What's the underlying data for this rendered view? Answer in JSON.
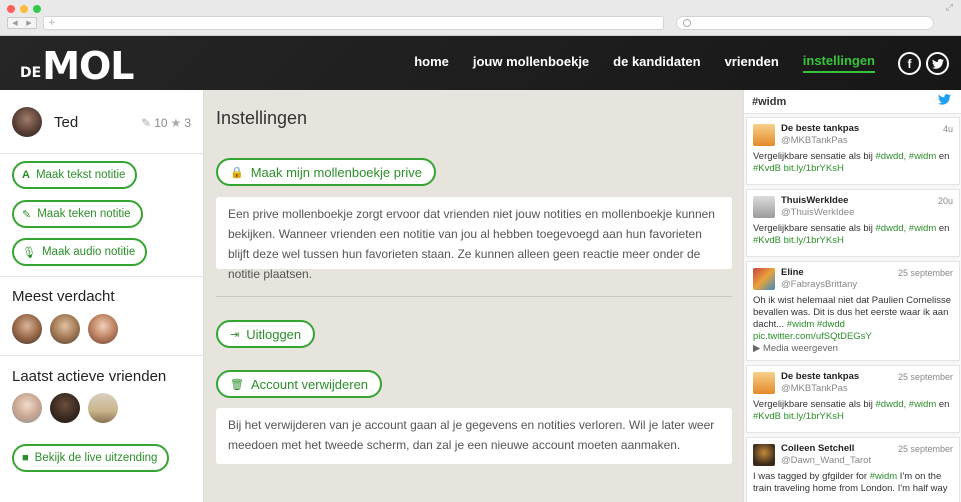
{
  "browser": {
    "new_tab_label": "+"
  },
  "brand": {
    "logo_de": "DE",
    "logo_mol": "MOL"
  },
  "nav": {
    "items": [
      "home",
      "jouw mollenboekje",
      "de kandidaten",
      "vrienden",
      "instellingen"
    ],
    "active": "instellingen",
    "facebook_label": "f"
  },
  "colors": {
    "accent": "#35a532",
    "accent_text": "#2b8f29",
    "nav_active": "#37c43b",
    "header_bg": "#1f1f1f",
    "twitter_blue": "#1da1f2"
  },
  "profile": {
    "name": "Ted",
    "edit_count": "10",
    "star_count": "3"
  },
  "sidebar": {
    "actions": [
      {
        "icon": "text-icon",
        "label": "Maak tekst notitie"
      },
      {
        "icon": "pencil-icon",
        "label": "Maak teken notitie"
      },
      {
        "icon": "microphone-icon",
        "label": "Maak audio notitie"
      }
    ],
    "most_suspected_title": "Meest verdacht",
    "recent_friends_title": "Laatst actieve vrienden",
    "live_button": "Bekijk de live uitzending"
  },
  "main": {
    "title": "Instellingen",
    "private_button": "Maak mijn mollenboekje prive",
    "private_text": "Een prive mollenboekje zorgt ervoor dat vrienden niet jouw notities en mollenboekje kunnen bekijken. Wanneer vrienden een notitie van jou al hebben toegevoegd aan hun favorieten blijft deze wel tussen hun favorieten staan. Ze kunnen alleen geen reactie meer onder de notitie plaatsen.",
    "logout_button": "Uitloggen",
    "delete_button": "Account verwijderen",
    "delete_text": "Bij het verwijderen van je account gaan al je gegevens en notities verloren. Wil je later weer meedoen met het tweede scherm, dan zal je een nieuwe account moeten aanmaken."
  },
  "twitter": {
    "hashtag": "#widm",
    "tweets": [
      {
        "name": "De beste tankpas",
        "handle": "@MKBTankPas",
        "time": "4u",
        "line1": "Vergelijkbare sensatie als bij ",
        "tags1": "#dwdd, #widm",
        "after1": " en",
        "line2": "#KvdB bit.ly/1brYKsH"
      },
      {
        "name": "ThuisWerkIdee",
        "handle": "@ThuisWerkIdee",
        "time": "20u",
        "line1": "Vergelijkbare sensatie als bij ",
        "tags1": "#dwdd, #widm",
        "after1": " en",
        "line2": "#KvdB bit.ly/1brYKsH"
      },
      {
        "name": "Eline",
        "handle": "@FabraysBrittany",
        "time": "25 september",
        "body": "Oh ik wist helemaal niet dat Paulien Cornelisse bevallen was. Dit is dus het eerste waar ik aan dacht...",
        "tags": " #widm #dwdd",
        "link": "pic.twitter.com/ufSQtDEGsY",
        "media": "Media weergeven"
      },
      {
        "name": "De beste tankpas",
        "handle": "@MKBTankPas",
        "time": "25 september",
        "line1": "Vergelijkbare sensatie als bij ",
        "tags1": "#dwdd, #widm",
        "after1": " en",
        "line2": "#KvdB bit.ly/1brYKsH"
      },
      {
        "name": "Colleen Setchell",
        "handle": "@Dawn_Wand_Tarot",
        "time": "25 september",
        "body_start": "I was tagged by gfgilder for ",
        "tag": "#widm",
        "body_end": " I'm on the train traveling home from London. I'm half way"
      }
    ]
  }
}
